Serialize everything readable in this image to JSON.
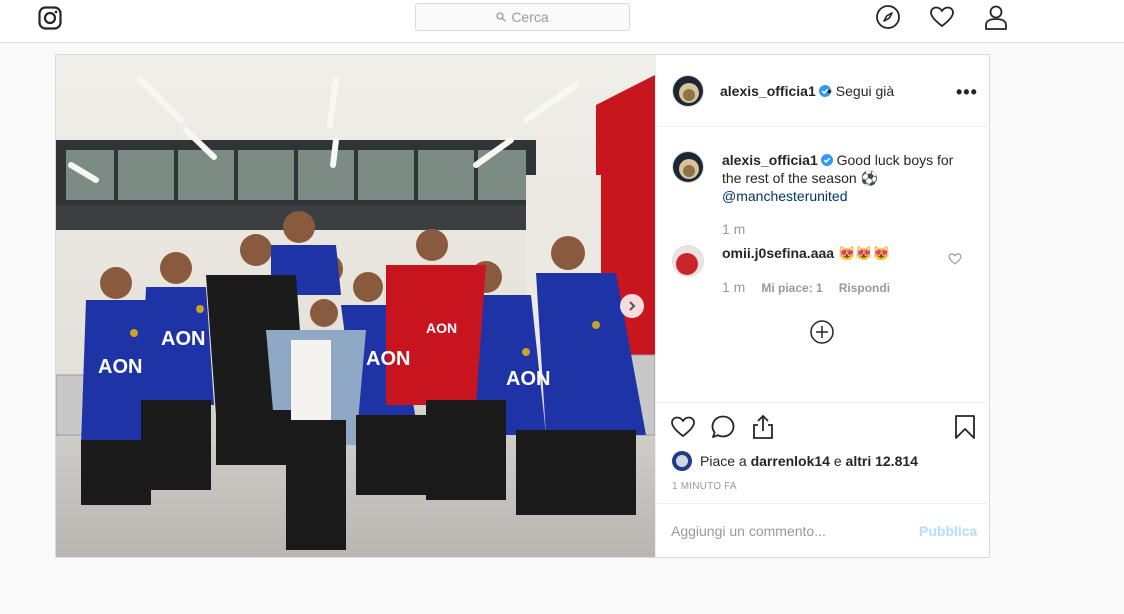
{
  "topbar": {
    "search_placeholder": "Cerca",
    "icons": [
      "instagram-logo-icon",
      "compass-icon",
      "heart-icon",
      "user-icon"
    ]
  },
  "post": {
    "author": "alexis_officia1",
    "verified": true,
    "follow_status": "• Segui già",
    "more_icon": "more-dots-icon",
    "caption": {
      "username": "alexis_officia1",
      "text": "Good luck boys for the rest of the season ⚽",
      "mention": "@manchesterunited",
      "time": "1 m"
    },
    "comments": [
      {
        "username": "omii.j0sefina.aaa",
        "text": "😻😻😻",
        "time": "1 m",
        "likes": "Mi piace: 1",
        "reply": "Rispondi"
      }
    ],
    "likes_text_prefix": "Piace a ",
    "likes_user": "darrenlok14",
    "likes_text_mid": " e ",
    "likes_others": "altri 12.814",
    "post_time": "1 MINUTO FA",
    "comment_placeholder": "Aggiungi un commento...",
    "publish_label": "Pubblica"
  },
  "colors": {
    "link": "#003569",
    "verified": "#3897f0",
    "publish_disabled": "#b2dffc",
    "muted": "#999999"
  }
}
